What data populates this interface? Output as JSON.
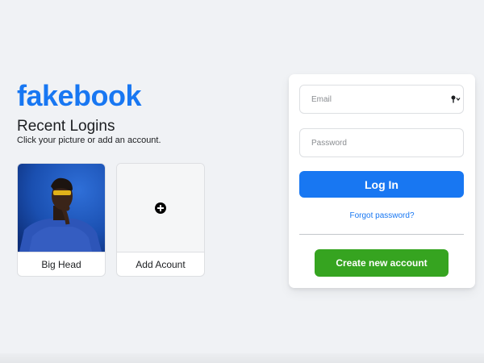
{
  "brand": {
    "logo_text": "fakebook",
    "color": "#1877f2"
  },
  "recent": {
    "title": "Recent Logins",
    "subtitle": "Click your picture or add an account.",
    "accounts": [
      {
        "name": "Big Head",
        "photo": "portrait of person in blue sweater on blue background"
      }
    ],
    "add_card": {
      "label": "Add Acount",
      "icon": "plus-circle-icon"
    }
  },
  "login_form": {
    "email_placeholder": "Email",
    "email_value": "",
    "email_icon": "key-icon",
    "password_placeholder": "Password",
    "password_value": "",
    "login_label": "Log In",
    "forgot_label": "Forgot password?",
    "create_label": "Create new account",
    "colors": {
      "primary": "#1877f2",
      "create": "#36a420"
    }
  }
}
